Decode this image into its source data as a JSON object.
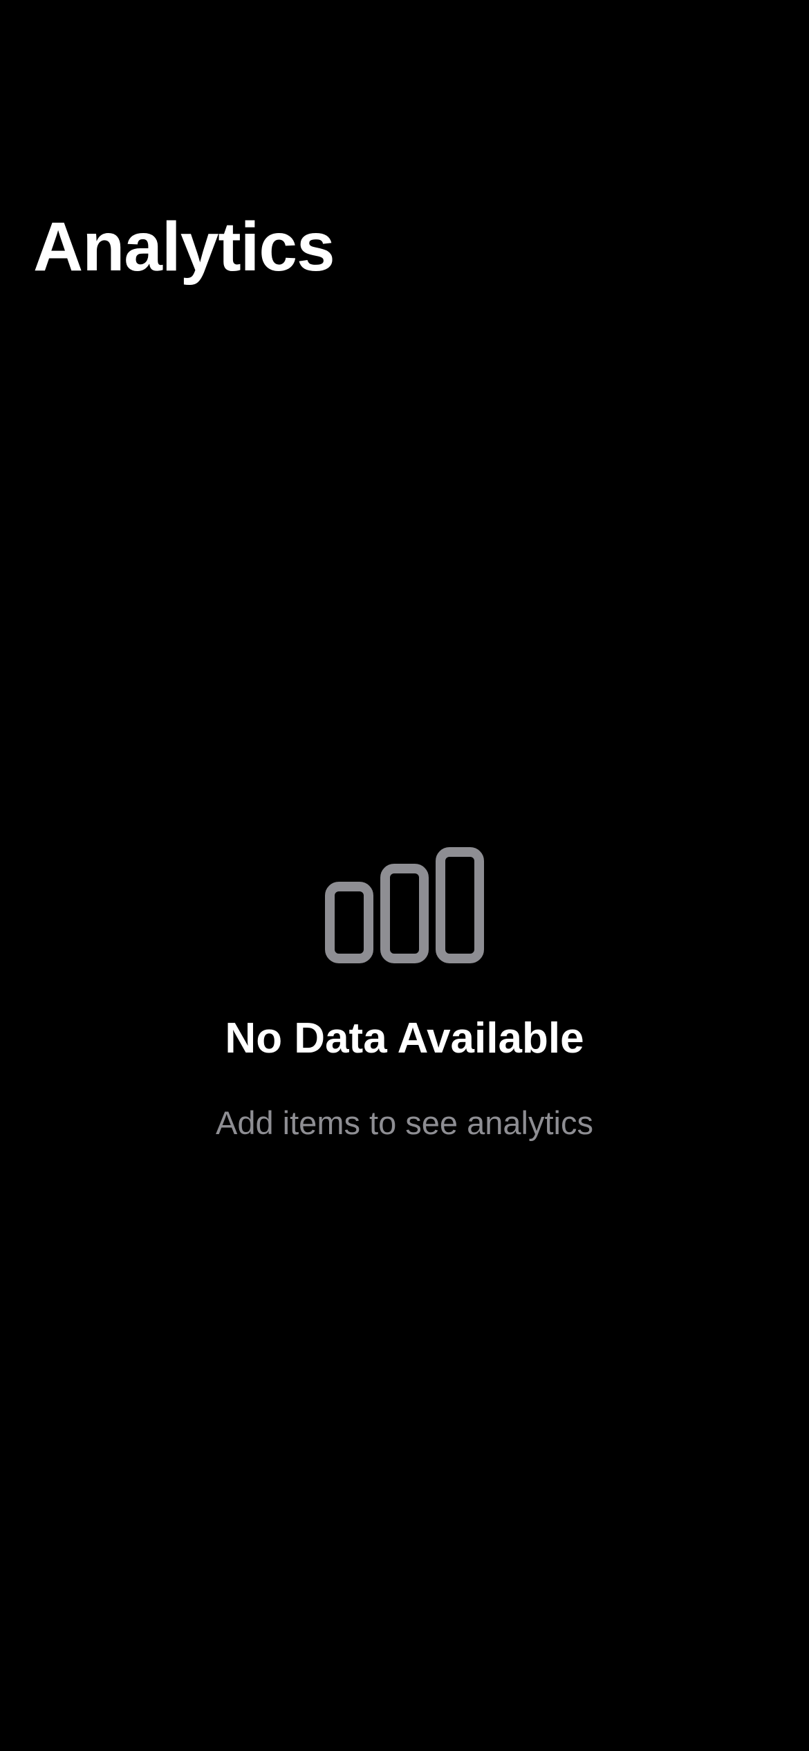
{
  "header": {
    "title": "Analytics"
  },
  "empty_state": {
    "icon": "bar-chart-icon",
    "title": "No Data Available",
    "subtitle": "Add items to see analytics"
  },
  "colors": {
    "background": "#000000",
    "primary_text": "#ffffff",
    "secondary_text": "#8e8e93",
    "icon": "#8e8e93"
  }
}
